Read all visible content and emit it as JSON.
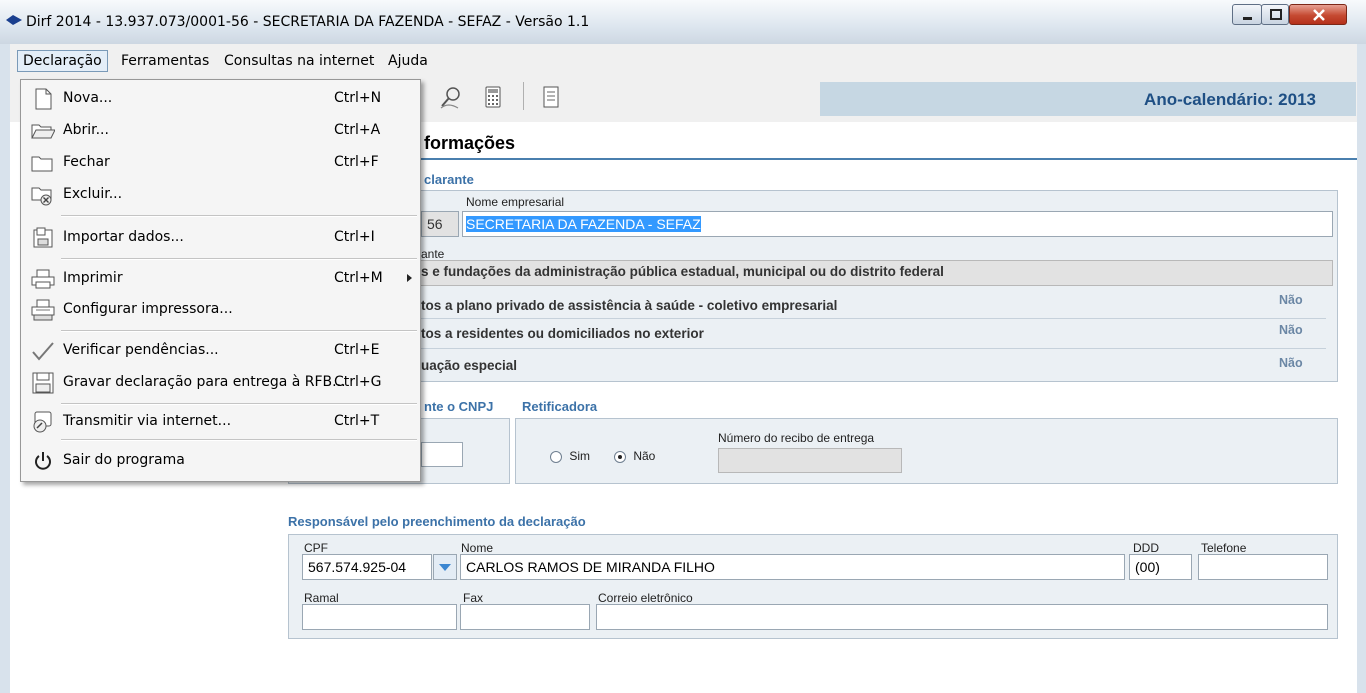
{
  "window": {
    "title": "Dirf 2014 - 13.937.073/0001-56 - SECRETARIA DA FAZENDA - SEFAZ - Versão 1.1"
  },
  "menubar": {
    "items": [
      "Declaração",
      "Ferramentas",
      "Consultas na internet",
      "Ajuda"
    ]
  },
  "toolbar": {
    "ano_calendario": "Ano-calendário: 2013"
  },
  "dropdown": {
    "items": [
      {
        "label": "Nova...",
        "shortcut": "Ctrl+N",
        "icon": "new-document-icon"
      },
      {
        "label": "Abrir...",
        "shortcut": "Ctrl+A",
        "icon": "open-folder-icon"
      },
      {
        "label": "Fechar",
        "shortcut": "Ctrl+F",
        "icon": "folder-icon"
      },
      {
        "label": "Excluir...",
        "shortcut": "",
        "icon": "delete-folder-icon"
      },
      {
        "label": "Importar dados...",
        "shortcut": "Ctrl+I",
        "icon": "import-icon"
      },
      {
        "label": "Imprimir",
        "shortcut": "Ctrl+M",
        "icon": "printer-icon"
      },
      {
        "label": "Configurar impressora...",
        "shortcut": "",
        "icon": "printer-settings-icon"
      },
      {
        "label": "Verificar pendências...",
        "shortcut": "Ctrl+E",
        "icon": "checkmark-icon"
      },
      {
        "label": "Gravar declaração para entrega à RFB...",
        "shortcut": "Ctrl+G",
        "icon": "save-disk-icon"
      },
      {
        "label": "Transmitir via internet...",
        "shortcut": "Ctrl+T",
        "icon": "transmit-icon"
      },
      {
        "label": "Sair do programa",
        "shortcut": "",
        "icon": "power-icon"
      }
    ]
  },
  "main": {
    "section_title": "formações",
    "declarante": {
      "group_title": "clarante",
      "cnpj_partial": "56",
      "nome_label": "Nome empresarial",
      "nome_value": "SECRETARIA DA FAZENDA - SEFAZ",
      "natureza_label_partial": "ante",
      "natureza_value": "s e fundações da administração pública estadual, municipal ou do distrito federal"
    },
    "rows": [
      {
        "text": "tos a plano privado de assistência à saúde - coletivo empresarial",
        "value": "Não"
      },
      {
        "text": "tos a residentes ou domiciliados no exterior",
        "value": "Não"
      },
      {
        "text": "uação especial",
        "value": "Não"
      }
    ],
    "cnpj_group_title": "nte o CNPJ",
    "retificadora": {
      "title": "Retificadora",
      "sim": "Sim",
      "nao": "Não",
      "selected": "Não",
      "recibo_label": "Número do recibo de entrega"
    },
    "responsavel": {
      "title": "Responsável pelo preenchimento da declaração",
      "cpf_label": "CPF",
      "cpf_value": "567.574.925-04",
      "nome_label": "Nome",
      "nome_value": "CARLOS RAMOS DE MIRANDA FILHO",
      "ddd_label": "DDD",
      "ddd_value": "(00)",
      "telefone_label": "Telefone",
      "ramal_label": "Ramal",
      "fax_label": "Fax",
      "email_label": "Correio eletrônico"
    }
  }
}
